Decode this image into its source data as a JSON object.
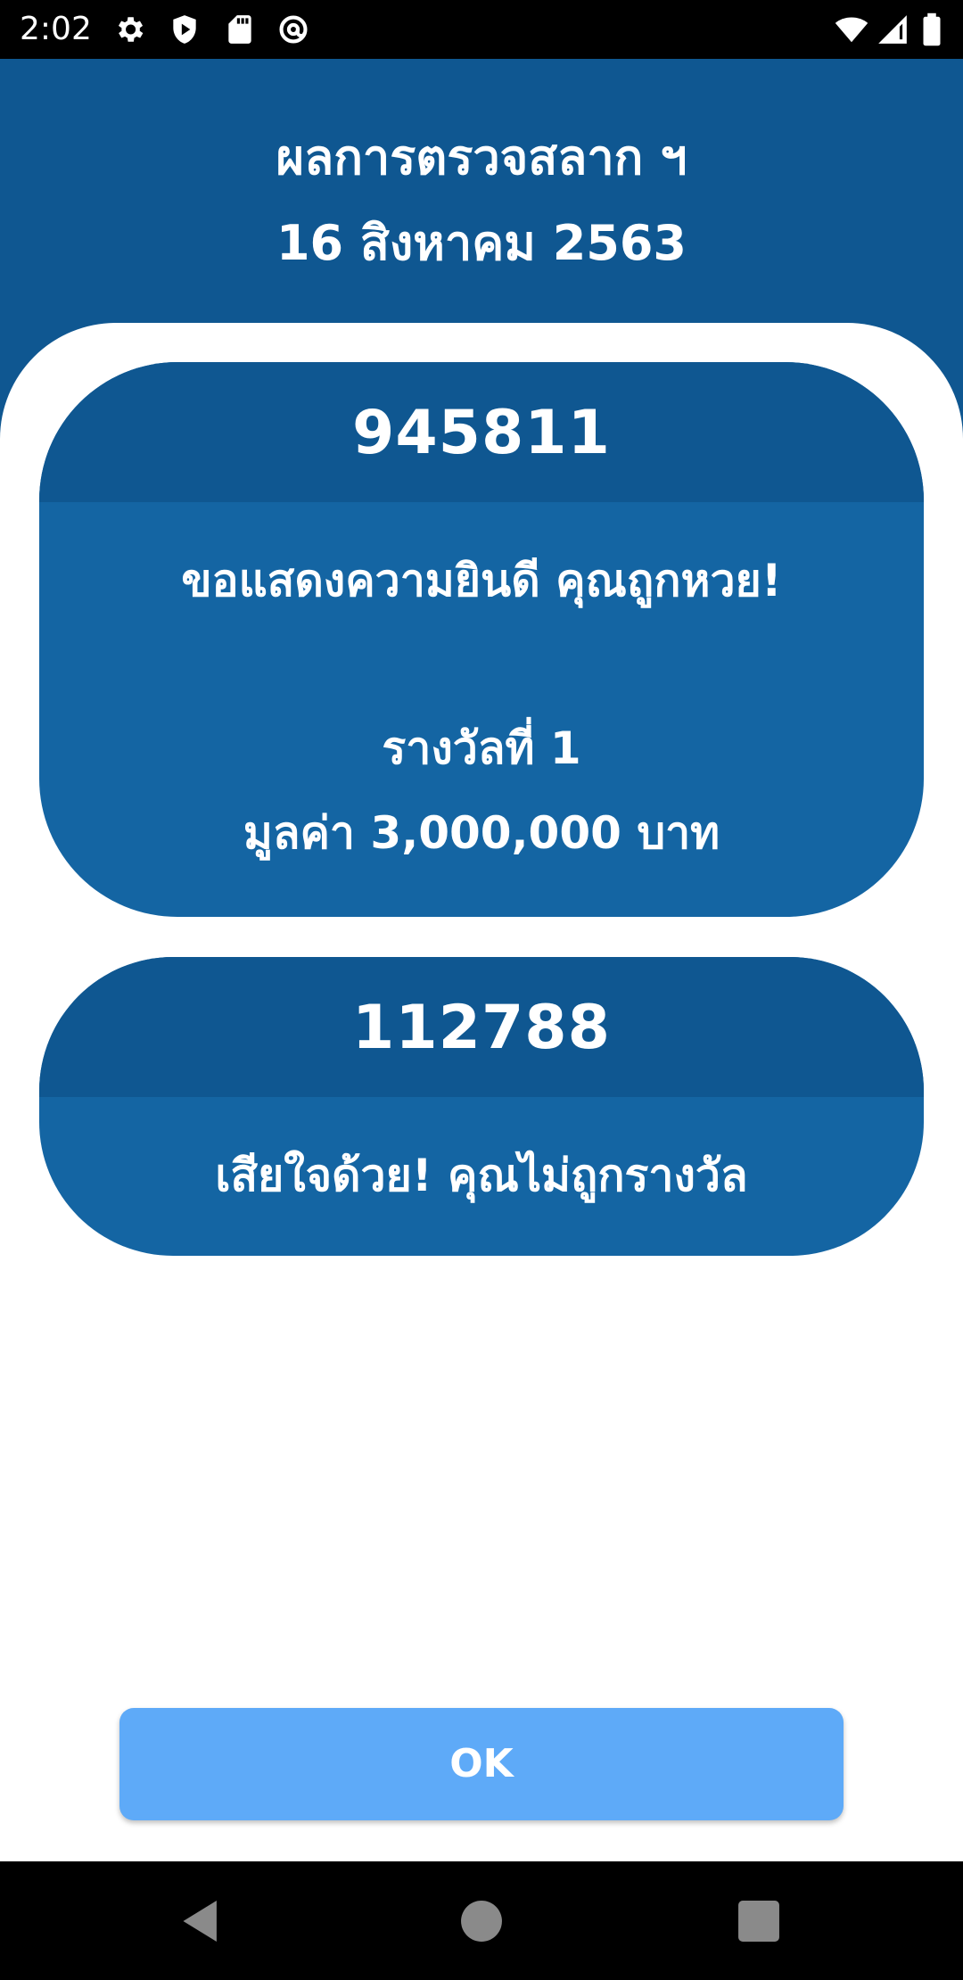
{
  "status_bar": {
    "time": "2:02",
    "left_icons": [
      "gear-icon",
      "shield-icon",
      "sd-card-icon",
      "at-sign-icon"
    ],
    "right_icons": [
      "wifi-icon",
      "signal-icon",
      "battery-icon"
    ]
  },
  "header": {
    "title": "ผลการตรวจสลาก ฯ",
    "date": "16 สิงหาคม 2563",
    "background_color": "#0f5791"
  },
  "results": [
    {
      "number": "945811",
      "message": "ขอแสดงความยินดี คุณถูกหวย!",
      "prize": "รางวัลที่ 1",
      "value": "มูลค่า 3,000,000 บาท"
    },
    {
      "number": "112788",
      "message": "เสียใจด้วย! คุณไม่ถูกรางวัล"
    }
  ],
  "ok_button": {
    "label": "OK",
    "color": "#5eaaf8"
  },
  "nav_bar": {
    "buttons": [
      "back-icon",
      "home-icon",
      "recents-icon"
    ]
  }
}
